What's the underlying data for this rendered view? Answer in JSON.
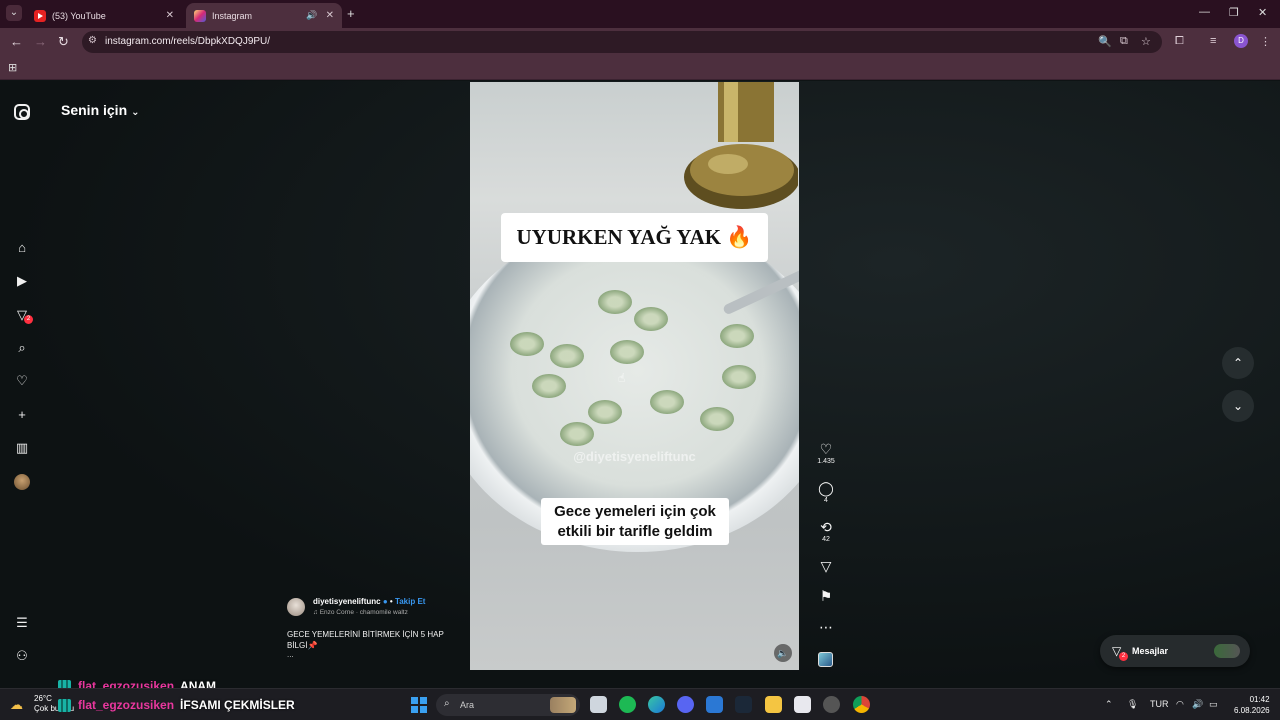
{
  "browser": {
    "tabs": [
      {
        "title": "(53) YouTube",
        "active": false
      },
      {
        "title": "Instagram",
        "active": true
      }
    ],
    "url": "instagram.com/reels/DbpkXDQJ9PU/",
    "profile_initial": "D"
  },
  "sidebar": {
    "feed_title": "Senin için",
    "notification_badge": "2"
  },
  "reel": {
    "overlay_title": "UYURKEN YAĞ YAK 🔥",
    "watermark": "@diyetisyeneliftunc",
    "overlay_caption": "Gece yemeleri için çok etkili bir tarifle geldim",
    "likes": "1.435",
    "comments": "4",
    "reposts": "42"
  },
  "post": {
    "author": "diyetisyeneliftunc",
    "follow_label": "Takip Et",
    "song": "Enzo Corne · chamomile waltz",
    "description": "GECE YEMELERİNİ BİTİRMEK İÇİN 5 HAP BİLGİ📌",
    "more": "..."
  },
  "messages": {
    "label": "Mesajlar",
    "badge": "2"
  },
  "chat": [
    {
      "user": "flat_egzozusiken",
      "message": "ANAM"
    },
    {
      "user": "flat_egzozusiken",
      "message": "İFSAMI ÇEKMİSLER"
    }
  ],
  "taskbar": {
    "temperature": "26°C",
    "weather": "Çok bulutlu",
    "search_placeholder": "Ara",
    "language": "TUR",
    "time": "01:42",
    "date": "6.08.2026"
  },
  "colors": {
    "tab_strip": "#2a1020",
    "toolbar": "#4d2f3e",
    "page_bg": "#0e1314",
    "link_blue": "#3897f0",
    "badge_red": "#ff3040",
    "chat_user": "#e9379e"
  }
}
